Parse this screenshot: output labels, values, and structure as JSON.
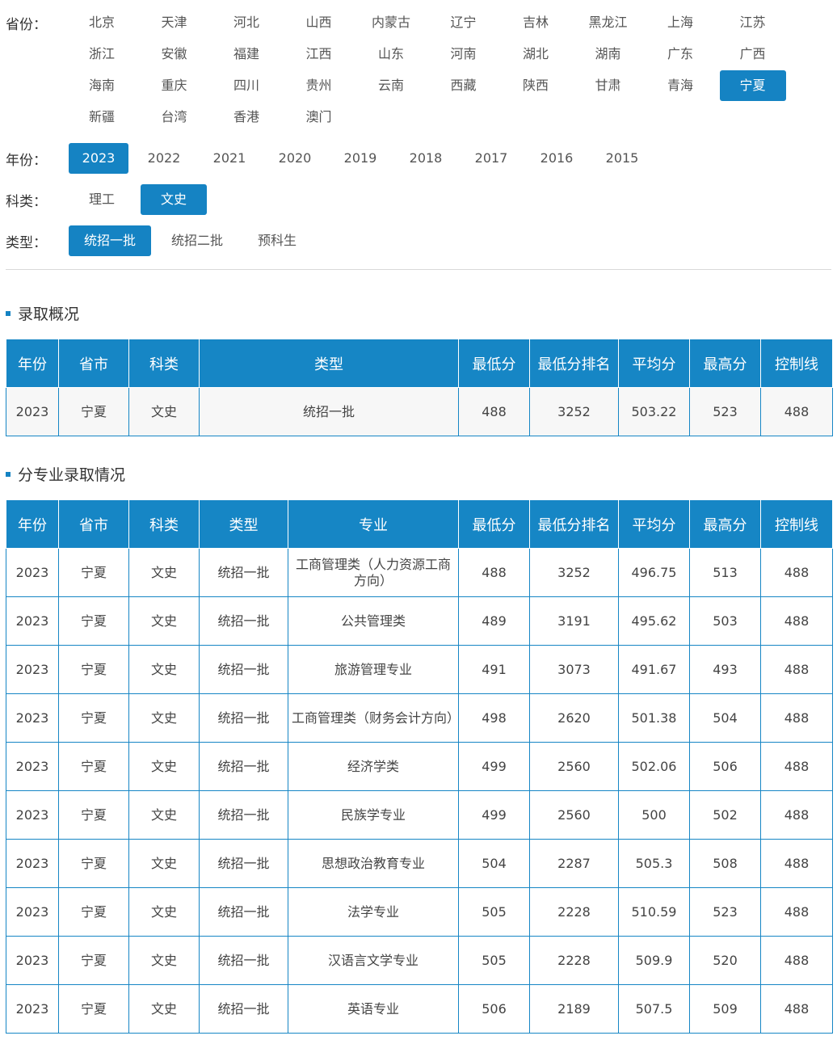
{
  "filters": {
    "province": {
      "label": "省份：",
      "options": [
        "北京",
        "天津",
        "河北",
        "山西",
        "内蒙古",
        "辽宁",
        "吉林",
        "黑龙江",
        "上海",
        "江苏",
        "浙江",
        "安徽",
        "福建",
        "江西",
        "山东",
        "河南",
        "湖北",
        "湖南",
        "广东",
        "广西",
        "海南",
        "重庆",
        "四川",
        "贵州",
        "云南",
        "西藏",
        "陕西",
        "甘肃",
        "青海",
        "宁夏",
        "新疆",
        "台湾",
        "香港",
        "澳门"
      ],
      "selected": "宁夏"
    },
    "year": {
      "label": "年份：",
      "options": [
        "2023",
        "2022",
        "2021",
        "2020",
        "2019",
        "2018",
        "2017",
        "2016",
        "2015"
      ],
      "selected": "2023"
    },
    "subject": {
      "label": "科类：",
      "options": [
        "理工",
        "文史"
      ],
      "selected": "文史"
    },
    "batch": {
      "label": "类型：",
      "options": [
        "统招一批",
        "统招二批",
        "预科生"
      ],
      "selected": "统招一批"
    }
  },
  "summary": {
    "title": "录取概况",
    "headers": [
      "年份",
      "省市",
      "科类",
      "类型",
      "最低分",
      "最低分排名",
      "平均分",
      "最高分",
      "控制线"
    ],
    "rows": [
      [
        "2023",
        "宁夏",
        "文史",
        "统招一批",
        "488",
        "3252",
        "503.22",
        "523",
        "488"
      ]
    ]
  },
  "detail": {
    "title": "分专业录取情况",
    "headers": [
      "年份",
      "省市",
      "科类",
      "类型",
      "专业",
      "最低分",
      "最低分排名",
      "平均分",
      "最高分",
      "控制线"
    ],
    "rows": [
      [
        "2023",
        "宁夏",
        "文史",
        "统招一批",
        "工商管理类（人力资源工商方向）",
        "488",
        "3252",
        "496.75",
        "513",
        "488"
      ],
      [
        "2023",
        "宁夏",
        "文史",
        "统招一批",
        "公共管理类",
        "489",
        "3191",
        "495.62",
        "503",
        "488"
      ],
      [
        "2023",
        "宁夏",
        "文史",
        "统招一批",
        "旅游管理专业",
        "491",
        "3073",
        "491.67",
        "493",
        "488"
      ],
      [
        "2023",
        "宁夏",
        "文史",
        "统招一批",
        "工商管理类（财务会计方向）",
        "498",
        "2620",
        "501.38",
        "504",
        "488"
      ],
      [
        "2023",
        "宁夏",
        "文史",
        "统招一批",
        "经济学类",
        "499",
        "2560",
        "502.06",
        "506",
        "488"
      ],
      [
        "2023",
        "宁夏",
        "文史",
        "统招一批",
        "民族学专业",
        "499",
        "2560",
        "500",
        "502",
        "488"
      ],
      [
        "2023",
        "宁夏",
        "文史",
        "统招一批",
        "思想政治教育专业",
        "504",
        "2287",
        "505.3",
        "508",
        "488"
      ],
      [
        "2023",
        "宁夏",
        "文史",
        "统招一批",
        "法学专业",
        "505",
        "2228",
        "510.59",
        "523",
        "488"
      ],
      [
        "2023",
        "宁夏",
        "文史",
        "统招一批",
        "汉语言文学专业",
        "505",
        "2228",
        "509.9",
        "520",
        "488"
      ],
      [
        "2023",
        "宁夏",
        "文史",
        "统招一批",
        "英语专业",
        "506",
        "2189",
        "507.5",
        "509",
        "488"
      ]
    ]
  },
  "colors": {
    "accent": "#1583c3",
    "header_bg": "#1686c5"
  }
}
